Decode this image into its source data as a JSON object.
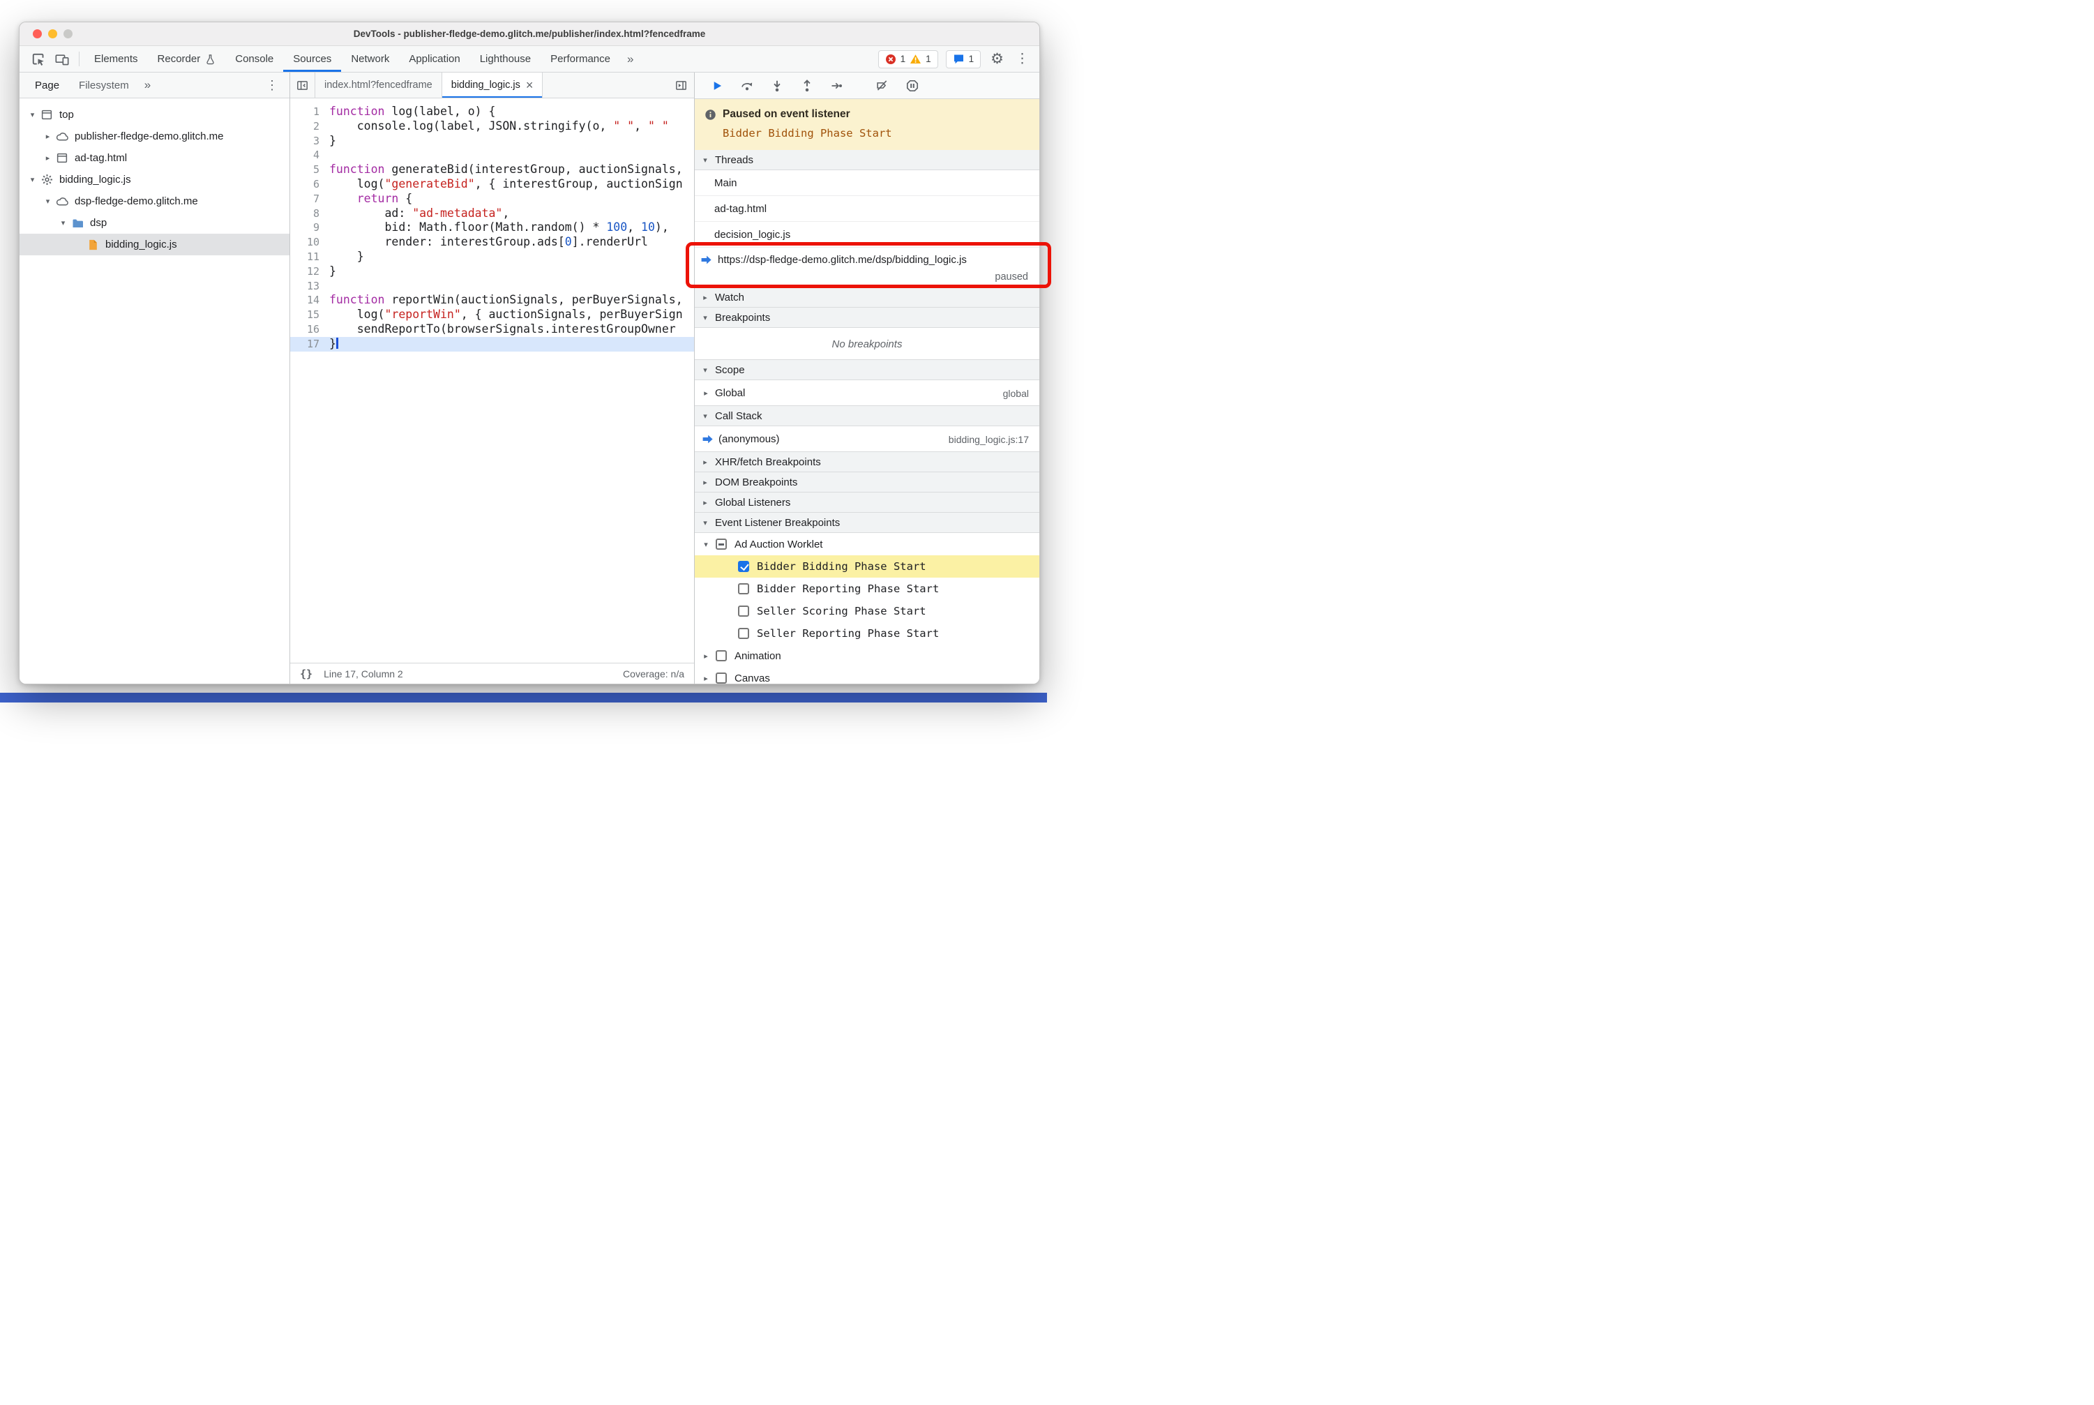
{
  "window": {
    "title": "DevTools - publisher-fledge-demo.glitch.me/publisher/index.html?fencedframe"
  },
  "glyphs": {
    "more_tabs": "»",
    "kebab": "⋮",
    "gear": "⚙",
    "close_tab": "×",
    "braces": "{}"
  },
  "toolbar": {
    "tabs": [
      {
        "label": "Elements"
      },
      {
        "label": "Recorder",
        "flask": true
      },
      {
        "label": "Console"
      },
      {
        "label": "Sources",
        "active": true
      },
      {
        "label": "Network"
      },
      {
        "label": "Application"
      },
      {
        "label": "Lighthouse"
      },
      {
        "label": "Performance"
      }
    ],
    "error_count": "1",
    "warning_count": "1",
    "issue_count": "1"
  },
  "sidebar": {
    "tabs": [
      {
        "label": "Page",
        "active": true
      },
      {
        "label": "Filesystem"
      }
    ],
    "tree": [
      {
        "label": "top",
        "icon": "frame",
        "depth": 0,
        "exp": "open"
      },
      {
        "label": "publisher-fledge-demo.glitch.me",
        "icon": "cloud",
        "depth": 1,
        "exp": "closed"
      },
      {
        "label": "ad-tag.html",
        "icon": "frame",
        "depth": 1,
        "exp": "closed"
      },
      {
        "label": "bidding_logic.js",
        "icon": "gear",
        "depth": 0,
        "exp": "open"
      },
      {
        "label": "dsp-fledge-demo.glitch.me",
        "icon": "cloud",
        "depth": 1,
        "exp": "open"
      },
      {
        "label": "dsp",
        "icon": "folder",
        "depth": 2,
        "exp": "open"
      },
      {
        "label": "bidding_logic.js",
        "icon": "jsfile",
        "depth": 3,
        "exp": "none",
        "selected": true
      }
    ]
  },
  "editor": {
    "tabs": [
      {
        "label": "index.html?fencedframe"
      },
      {
        "label": "bidding_logic.js",
        "active": true,
        "closable": true
      }
    ],
    "pretty_print": "{}",
    "status_left": "Line 17, Column 2",
    "status_right": "Coverage: n/a",
    "lines": [
      {
        "n": 1,
        "tokens": [
          [
            "kw",
            "function"
          ],
          [
            "pl",
            " log(label, o) {"
          ]
        ]
      },
      {
        "n": 2,
        "tokens": [
          [
            "pl",
            "    console.log(label, JSON.stringify(o, "
          ],
          [
            "str",
            "\" \""
          ],
          [
            "pl",
            ", "
          ],
          [
            "str",
            "\" \""
          ]
        ]
      },
      {
        "n": 3,
        "tokens": [
          [
            "pl",
            "}"
          ]
        ]
      },
      {
        "n": 4,
        "tokens": []
      },
      {
        "n": 5,
        "tokens": [
          [
            "kw",
            "function"
          ],
          [
            "pl",
            " generateBid(interestGroup, auctionSignals, "
          ]
        ]
      },
      {
        "n": 6,
        "tokens": [
          [
            "pl",
            "    log("
          ],
          [
            "str",
            "\"generateBid\""
          ],
          [
            "pl",
            ", { interestGroup, auctionSign"
          ]
        ]
      },
      {
        "n": 7,
        "tokens": [
          [
            "pl",
            "    "
          ],
          [
            "kw",
            "return"
          ],
          [
            "pl",
            " {"
          ]
        ]
      },
      {
        "n": 8,
        "tokens": [
          [
            "pl",
            "        ad: "
          ],
          [
            "str",
            "\"ad-metadata\""
          ],
          [
            "pl",
            ","
          ]
        ]
      },
      {
        "n": 9,
        "tokens": [
          [
            "pl",
            "        bid: Math.floor(Math.random() * "
          ],
          [
            "num",
            "100"
          ],
          [
            "pl",
            ", "
          ],
          [
            "num",
            "10"
          ],
          [
            "pl",
            "),"
          ]
        ]
      },
      {
        "n": 10,
        "tokens": [
          [
            "pl",
            "        render: interestGroup.ads["
          ],
          [
            "num",
            "0"
          ],
          [
            "pl",
            "].renderUrl"
          ]
        ]
      },
      {
        "n": 11,
        "tokens": [
          [
            "pl",
            "    }"
          ]
        ]
      },
      {
        "n": 12,
        "tokens": [
          [
            "pl",
            "}"
          ]
        ]
      },
      {
        "n": 13,
        "tokens": []
      },
      {
        "n": 14,
        "tokens": [
          [
            "kw",
            "function"
          ],
          [
            "pl",
            " reportWin(auctionSignals, perBuyerSignals, "
          ]
        ]
      },
      {
        "n": 15,
        "tokens": [
          [
            "pl",
            "    log("
          ],
          [
            "str",
            "\"reportWin\""
          ],
          [
            "pl",
            ", { auctionSignals, perBuyerSign"
          ]
        ]
      },
      {
        "n": 16,
        "tokens": [
          [
            "pl",
            "    sendReportTo(browserSignals.interestGroupOwner"
          ]
        ]
      },
      {
        "n": 17,
        "tokens": [
          [
            "pl",
            "}"
          ]
        ],
        "paused": true
      }
    ]
  },
  "debugger": {
    "toolbar_icons": [
      "resume",
      "step-over",
      "step-into",
      "step-out",
      "step",
      "deactivate-breakpoints",
      "pause-on-exceptions"
    ],
    "banner": {
      "title": "Paused on event listener",
      "subtitle": "Bidder Bidding Phase Start"
    },
    "threads": {
      "title": "Threads",
      "items": [
        {
          "label": "Main"
        },
        {
          "label": "ad-tag.html"
        },
        {
          "label": "decision_logic.js"
        },
        {
          "label": "https://dsp-fledge-demo.glitch.me/dsp/bidding_logic.js",
          "status": "paused",
          "current": true
        }
      ]
    },
    "watch": {
      "title": "Watch"
    },
    "breakpoints": {
      "title": "Breakpoints",
      "empty": "No breakpoints"
    },
    "scope": {
      "title": "Scope",
      "rows": [
        {
          "label": "Global",
          "value": "global"
        }
      ]
    },
    "call_stack": {
      "title": "Call Stack",
      "rows": [
        {
          "label": "(anonymous)",
          "value": "bidding_logic.js:17",
          "current": true
        }
      ]
    },
    "xhr": {
      "title": "XHR/fetch Breakpoints"
    },
    "dom": {
      "title": "DOM Breakpoints"
    },
    "global_listeners": {
      "title": "Global Listeners"
    },
    "event_listener_breakpoints": {
      "title": "Event Listener Breakpoints",
      "groups": [
        {
          "label": "Ad Auction Worklet",
          "state": "indeterminate",
          "expanded": true,
          "children": [
            {
              "label": "Bidder Bidding Phase Start",
              "checked": true,
              "highlighted": true
            },
            {
              "label": "Bidder Reporting Phase Start",
              "checked": false
            },
            {
              "label": "Seller Scoring Phase Start",
              "checked": false
            },
            {
              "label": "Seller Reporting Phase Start",
              "checked": false
            }
          ]
        },
        {
          "label": "Animation",
          "state": "unchecked",
          "expanded": false,
          "children": []
        },
        {
          "label": "Canvas",
          "state": "unchecked",
          "expanded": false,
          "children": []
        }
      ]
    }
  }
}
